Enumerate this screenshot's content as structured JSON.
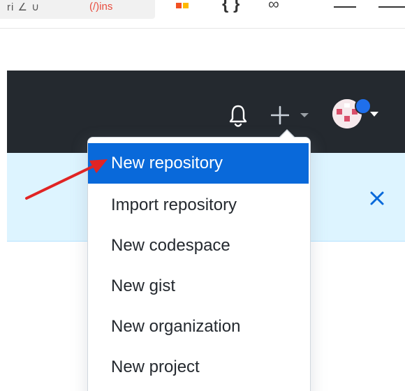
{
  "browser": {
    "address_fragment": "ri ∠ ∪",
    "address_red_fragment": "(/)ins",
    "icons": [
      "windows-icon",
      "braces-icon",
      "infinity-icon",
      "minimize-icon"
    ]
  },
  "header": {
    "icons": [
      "bell-icon",
      "plus-icon",
      "caret-down-icon",
      "avatar"
    ]
  },
  "banner": {
    "close_icon": "close-icon"
  },
  "new_menu": {
    "items": [
      {
        "label": "New repository",
        "active": true
      },
      {
        "label": "Import repository",
        "active": false
      },
      {
        "label": "New codespace",
        "active": false
      },
      {
        "label": "New gist",
        "active": false
      },
      {
        "label": "New organization",
        "active": false
      },
      {
        "label": "New project",
        "active": false
      }
    ]
  },
  "colors": {
    "header_bg": "#24292f",
    "banner_bg": "#ddf4ff",
    "menu_active_bg": "#0969da",
    "annotation_arrow": "#e02424",
    "banner_close": "#0969da",
    "avatar_dot": "#1f6feb"
  }
}
